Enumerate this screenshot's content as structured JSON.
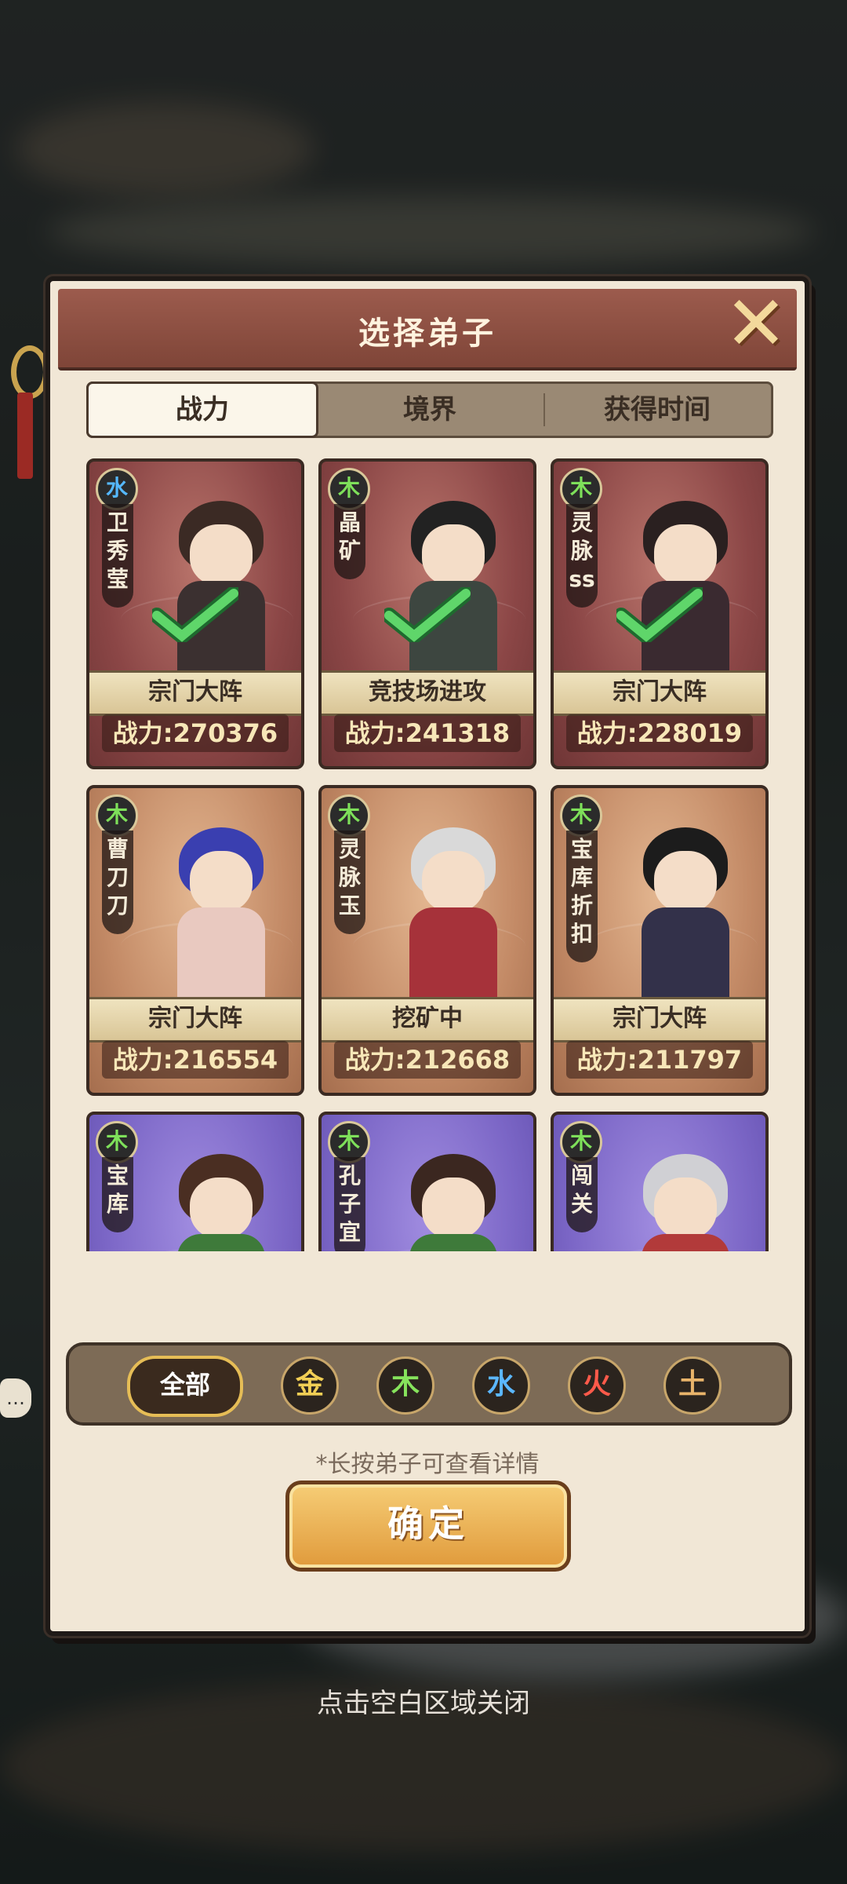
{
  "dialog": {
    "title": "选择弟子",
    "close_icon": "close-x-icon"
  },
  "sort_tabs": [
    {
      "label": "战力",
      "active": true
    },
    {
      "label": "境界",
      "active": false
    },
    {
      "label": "获得时间",
      "active": false
    }
  ],
  "disciples": [
    {
      "element": "水",
      "name": "卫秀莹",
      "status": "宗门大阵",
      "power": "战力:270376",
      "selected": true,
      "frame": "red"
    },
    {
      "element": "木",
      "name": "晶矿",
      "status": "竞技场进攻",
      "power": "战力:241318",
      "selected": true,
      "frame": "red"
    },
    {
      "element": "木",
      "name": "灵脉ss",
      "status": "宗门大阵",
      "power": "战力:228019",
      "selected": true,
      "frame": "red"
    },
    {
      "element": "木",
      "name": "曹刀刀",
      "status": "宗门大阵",
      "power": "战力:216554",
      "selected": false,
      "frame": "orange"
    },
    {
      "element": "木",
      "name": "灵脉玉",
      "status": "挖矿中",
      "power": "战力:212668",
      "selected": false,
      "frame": "orange"
    },
    {
      "element": "木",
      "name": "宝库折扣",
      "status": "宗门大阵",
      "power": "战力:211797",
      "selected": false,
      "frame": "orange"
    },
    {
      "element": "木",
      "name": "宝库",
      "status": "",
      "power": "",
      "selected": false,
      "frame": "purple"
    },
    {
      "element": "木",
      "name": "孔子宜",
      "status": "",
      "power": "",
      "selected": false,
      "frame": "purple"
    },
    {
      "element": "木",
      "name": "闯关",
      "status": "",
      "power": "",
      "selected": false,
      "frame": "purple"
    }
  ],
  "filters": {
    "all_label": "全部",
    "elements": [
      {
        "label": "金",
        "color": "#f2cf55"
      },
      {
        "label": "木",
        "color": "#86e35c"
      },
      {
        "label": "水",
        "color": "#5bb7ff"
      },
      {
        "label": "火",
        "color": "#ff5a4a"
      },
      {
        "label": "土",
        "color": "#e9b46a"
      }
    ]
  },
  "hint": "*长按弟子可查看详情",
  "confirm_label": "确定",
  "close_hint": "点击空白区域关闭"
}
